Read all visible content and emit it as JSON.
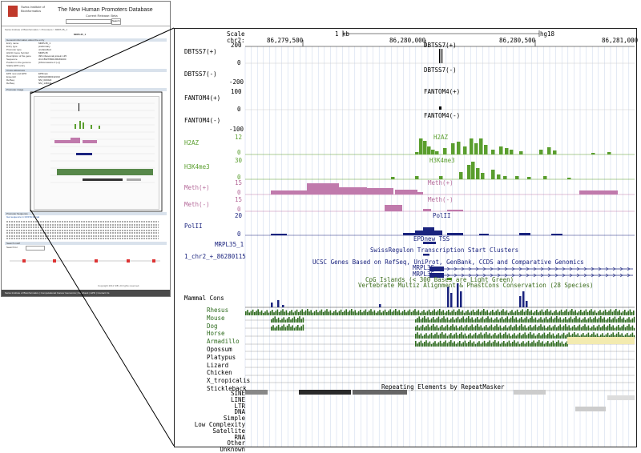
{
  "thumbnail": {
    "site_title": "The New Human Promoters Database",
    "site_subtitle": "Current Release: Beta",
    "org_name": "Swiss Institute of Bioinformatics",
    "search_button": "Search",
    "breadcrumb": "Swiss Institute of Bioinformatics > Promoters > MRPL35_1",
    "entry_title": "MRPL35_1",
    "section_general": "General information about the entry",
    "fields": [
      {
        "label": "Entry name",
        "value": "MRPL35_1"
      },
      {
        "label": "Entry type",
        "value": "preliminary"
      },
      {
        "label": "Promoter type",
        "value": "unclassified"
      },
      {
        "label": "HGNC Gene Symbol",
        "value": "MRPL35"
      },
      {
        "label": "Description of the gene",
        "value": "39S ribosomal protein L35"
      },
      {
        "label": "Sequence",
        "value": "chr2:86279500-86281000"
      },
      {
        "label": "Position in the genome",
        "value": "[Chromosome 2 (+)]"
      },
      {
        "label": "Stable EPD entry",
        "value": ""
      }
    ],
    "section_crossrefs": "Cross-references",
    "crossrefs": [
      {
        "label": "EPD new and EPD",
        "value": "EPDnew"
      },
      {
        "label": "Ensembl",
        "value": "ENSG00000132313"
      },
      {
        "label": "RefSeq",
        "value": "NM_016622"
      },
      {
        "label": "RefSeq",
        "value": "NM_145644"
      }
    ],
    "section_promoter_image": "Promoter image",
    "section_sequence": "Promoter Sequence",
    "seq_hint": "Get sequence in FASTA format",
    "section_search_motif": "Search motif",
    "motif_label": "Search for",
    "copyright": "Copyright 2011 SIB. All rights reserved.",
    "footer": "Swiss Institute of Bioinformatics | Computational Cancer Genomics | Feedback | EPD | Contact Us"
  },
  "browser": {
    "scale_label": "Scale",
    "scale_value": "1 kb",
    "assembly": "hg18",
    "chrom_label": "chr2:",
    "positions": [
      "86,279,500",
      "86,280,000",
      "86,280,500",
      "86,281,000"
    ],
    "tracks": {
      "dbtss_plus": "DBTSS7(+)",
      "dbtss_minus": "DBTSS7(-)",
      "dbtss_top": "200",
      "dbtss_zero": "0",
      "dbtss_bottom": "-200",
      "dbtss_center_plus": "DBTSS7(+)",
      "dbtss_center_minus": "DBTSS7(-)",
      "fantom_plus": "FANTOM4(+)",
      "fantom_minus": "FANTOM4(-)",
      "fantom_top": "100",
      "fantom_zero": "0",
      "fantom_bottom": "-100",
      "fantom_center_plus": "FANTOM4(+)",
      "fantom_center_minus": "FANTOM4(-)",
      "h2az": "H2AZ",
      "h2az_top": "12",
      "h2az_zero": "0",
      "h3k4me3": "H3K4me3",
      "h3k4me3_top": "30",
      "h3k4me3_zero": "0",
      "meth_plus": "Meth(+)",
      "meth_minus": "Meth(-)",
      "meth_plus_top": "15",
      "meth_plus_zero": "0",
      "meth_minus_top": "15",
      "meth_minus_zero": "0",
      "polii": "PolII",
      "polii_top": "20",
      "polii_zero": "0",
      "epdnew": "EPDnew TSS",
      "mrpl35_1": "MRPL35_1",
      "swissregion": "SwissRegulon Transcription Start Clusters",
      "swissregion_id": "1_chr2_+_86280115",
      "ucsc_genes": "UCSC Genes Based on RefSeq, UniProt, GenBank, CCDS and Comparative Genomics",
      "gene1": "MRPL35",
      "gene2": "MRPL35",
      "cpg": "CpG Islands (< 300 Bases are Light Green)",
      "conservation": "Vertebrate Multiz Alignment & PhastCons Conservation (28 Species)",
      "mammal_cons": "Mammal Cons",
      "species": [
        "Rhesus",
        "Mouse",
        "Dog",
        "Horse",
        "Armadillo",
        "Opossum",
        "Platypus",
        "Lizard",
        "Chicken",
        "X_tropicalis",
        "Stickleback"
      ],
      "repeats_title": "Repeating Elements by RepeatMasker",
      "repeat_classes": [
        "SINE",
        "LINE",
        "LTR",
        "DNA",
        "Simple",
        "Low Complexity",
        "Satellite",
        "RNA",
        "Other",
        "Unknown"
      ]
    },
    "colors": {
      "green": "#5a9e2e",
      "pink": "#c07aac",
      "navy": "#1a237e",
      "conservation": "#2e6b1e",
      "repeat": "#555555"
    }
  }
}
